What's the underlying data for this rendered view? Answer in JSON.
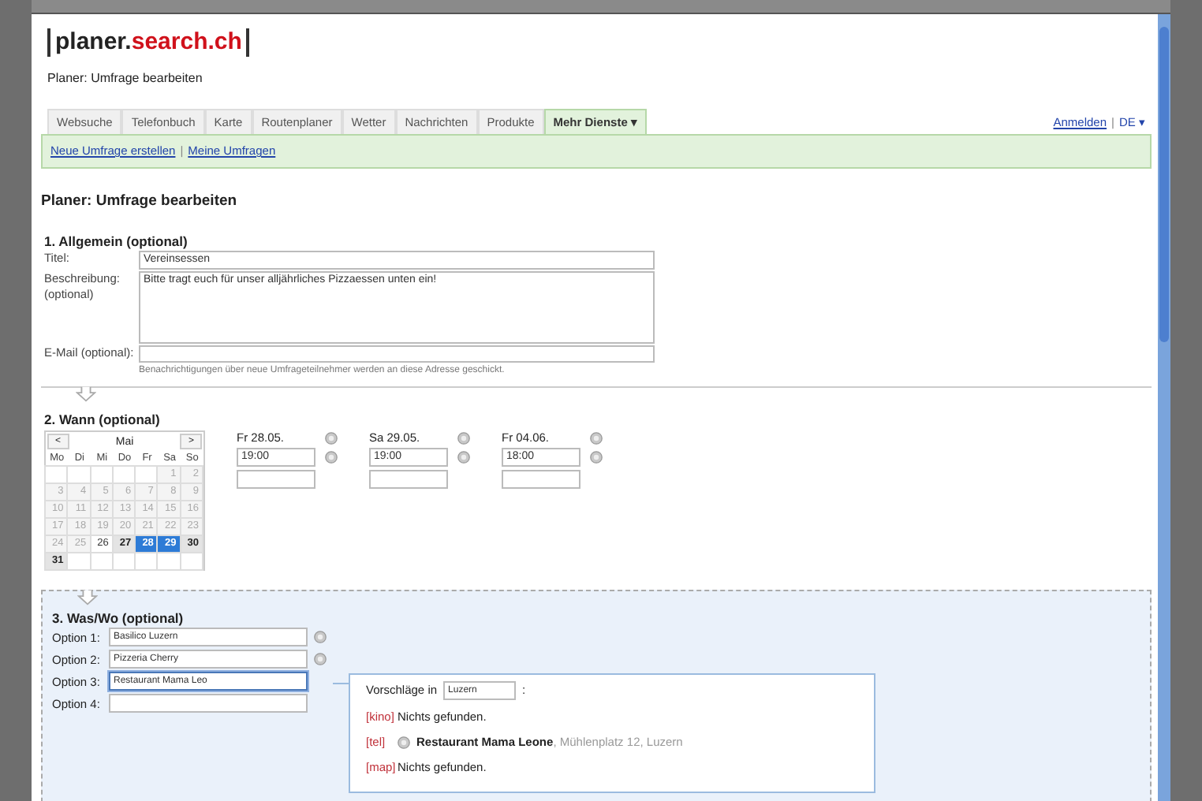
{
  "logo": {
    "left": "planer.",
    "right": "search.ch"
  },
  "subtitle": "Planer: Umfrage bearbeiten",
  "tabs": [
    {
      "label": "Websuche",
      "selected": false
    },
    {
      "label": "Telefonbuch",
      "selected": false
    },
    {
      "label": "Karte",
      "selected": false
    },
    {
      "label": "Routenplaner",
      "selected": false
    },
    {
      "label": "Wetter",
      "selected": false
    },
    {
      "label": "Nachrichten",
      "selected": false
    },
    {
      "label": "Produkte",
      "selected": false
    },
    {
      "label": "Mehr Dienste ▾",
      "selected": true
    }
  ],
  "account": {
    "login": "Anmelden",
    "separator": "|",
    "language": "DE ▾"
  },
  "subnav": {
    "links": [
      "Neue Umfrage erstellen",
      "Meine Umfragen"
    ],
    "separator": "|"
  },
  "heading": "Planer: Umfrage bearbeiten",
  "general": {
    "title": "1. Allgemein (optional)",
    "fields": [
      {
        "label": "Titel:",
        "value": "Vereinsessen",
        "kind": "line"
      },
      {
        "label": "Beschreibung: (optional)",
        "value": "Bitte tragt euch für unser alljährliches Pizzaessen unten ein!",
        "kind": "area"
      },
      {
        "label": "E-Mail (optional):",
        "kind": "line",
        "hint": "Benachrichtigungen über neue Umfrageteilnehmer werden an diese Adresse geschickt."
      }
    ]
  },
  "when": {
    "title": "2. Wann (optional)",
    "calendar": {
      "prev": "<",
      "month": "Mai",
      "next": ">",
      "weekdays": [
        "Mo",
        "Di",
        "Mi",
        "Do",
        "Fr",
        "Sa",
        "So"
      ],
      "days": [
        {
          "kind": "empty"
        },
        {
          "kind": "empty"
        },
        {
          "kind": "empty"
        },
        {
          "kind": "empty"
        },
        {
          "kind": "empty"
        },
        {
          "day": "1",
          "kind": "past",
          "selected": false
        },
        {
          "day": "2",
          "kind": "past",
          "selected": false
        },
        {
          "day": "3",
          "kind": "past",
          "selected": false
        },
        {
          "day": "4",
          "kind": "past",
          "selected": false
        },
        {
          "day": "5",
          "kind": "past",
          "selected": false
        },
        {
          "day": "6",
          "kind": "past",
          "selected": false
        },
        {
          "day": "7",
          "kind": "past",
          "selected": false
        },
        {
          "day": "8",
          "kind": "past",
          "selected": false
        },
        {
          "day": "9",
          "kind": "past",
          "selected": false
        },
        {
          "day": "10",
          "kind": "past",
          "selected": false
        },
        {
          "day": "11",
          "kind": "past",
          "selected": false
        },
        {
          "day": "12",
          "kind": "past",
          "selected": false
        },
        {
          "day": "13",
          "kind": "past",
          "selected": false
        },
        {
          "day": "14",
          "kind": "past",
          "selected": false
        },
        {
          "day": "15",
          "kind": "past",
          "selected": false
        },
        {
          "day": "16",
          "kind": "past",
          "selected": false
        },
        {
          "day": "17",
          "kind": "past",
          "selected": false
        },
        {
          "day": "18",
          "kind": "past",
          "selected": false
        },
        {
          "day": "19",
          "kind": "past",
          "selected": false
        },
        {
          "day": "20",
          "kind": "past",
          "selected": false
        },
        {
          "day": "21",
          "kind": "past",
          "selected": false
        },
        {
          "day": "22",
          "kind": "past",
          "selected": false
        },
        {
          "day": "23",
          "kind": "past",
          "selected": false
        },
        {
          "day": "24",
          "kind": "past",
          "selected": false
        },
        {
          "day": "25",
          "kind": "past",
          "selected": false
        },
        {
          "day": "26",
          "kind": "open",
          "selected": false
        },
        {
          "day": "27",
          "kind": "highlight",
          "selected": false
        },
        {
          "day": "28",
          "kind": "highlight",
          "selected": true
        },
        {
          "day": "29",
          "kind": "highlight",
          "selected": true
        },
        {
          "day": "30",
          "kind": "highlight",
          "selected": false
        },
        {
          "day": "31",
          "kind": "highlight",
          "selected": false
        },
        {
          "kind": "empty"
        },
        {
          "kind": "empty"
        },
        {
          "kind": "empty"
        },
        {
          "kind": "empty"
        },
        {
          "kind": "empty"
        },
        {
          "kind": "empty"
        }
      ]
    },
    "dates": [
      {
        "date": "Fr 28.05.",
        "times": [
          "19:00"
        ]
      },
      {
        "date": "Sa 29.05.",
        "times": [
          "19:00"
        ]
      },
      {
        "date": "Fr 04.06.",
        "times": [
          "18:00"
        ]
      }
    ]
  },
  "what": {
    "title": "3. Was/Wo (optional)",
    "options": [
      {
        "label": "Option 1:",
        "value": "Basilico Luzern",
        "focused": false
      },
      {
        "label": "Option 2:",
        "value": "Pizzeria Cherry",
        "focused": false
      },
      {
        "label": "Option 3:",
        "value": "Restaurant Mama Leo",
        "focused": true
      },
      {
        "label": "Option 4:",
        "focused": false
      }
    ],
    "suggestions": {
      "label": "Vorschläge in",
      "location": "Luzern",
      "suffix": ":",
      "results": [
        {
          "tag": "[kino]",
          "text": "Nichts gefunden.",
          "found": false
        },
        {
          "tag": "[tel]",
          "text": "**Restaurant Mama Leone**, Mühlenplatz 12, Luzern",
          "found": true
        },
        {
          "tag": "[map]",
          "text": "Nichts gefunden.",
          "found": false
        }
      ]
    }
  }
}
